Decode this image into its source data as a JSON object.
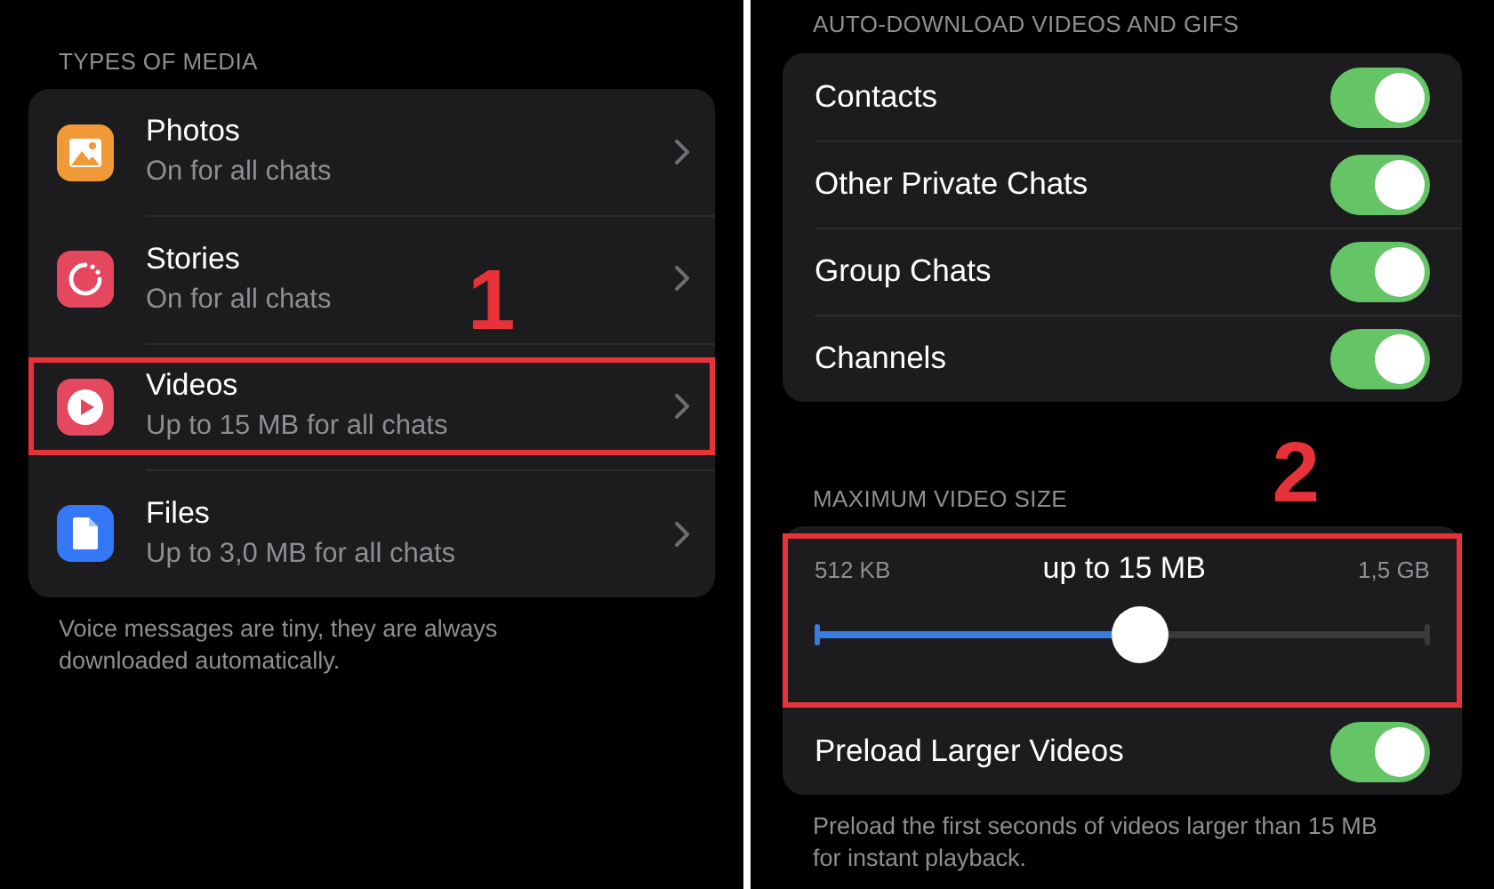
{
  "left": {
    "header": "TYPES OF MEDIA",
    "items": [
      {
        "kind": "photo",
        "color": "#f09a37",
        "title": "Photos",
        "subtitle": "On for all chats",
        "highlighted": false
      },
      {
        "kind": "story",
        "color": "#e5475f",
        "title": "Stories",
        "subtitle": "On for all chats",
        "highlighted": false
      },
      {
        "kind": "video",
        "color": "#e5475f",
        "title": "Videos",
        "subtitle": "Up to 15 MB for all chats",
        "highlighted": true
      },
      {
        "kind": "file",
        "color": "#3478f6",
        "title": "Files",
        "subtitle": "Up to 3,0 MB for all chats",
        "highlighted": false
      }
    ],
    "annotation": "1",
    "footer": "Voice messages are tiny, they are always downloaded automatically."
  },
  "right": {
    "header": "AUTO-DOWNLOAD VIDEOS AND GIFS",
    "toggles": [
      {
        "label": "Contacts",
        "on": true
      },
      {
        "label": "Other Private Chats",
        "on": true
      },
      {
        "label": "Group Chats",
        "on": true
      },
      {
        "label": "Channels",
        "on": true
      }
    ],
    "annotation": "2",
    "size_header": "MAXIMUM VIDEO SIZE",
    "slider": {
      "min": "512 KB",
      "value": "up to 15 MB",
      "max": "1,5 GB",
      "level": 0.53,
      "highlighted": true
    },
    "preload": {
      "label": "Preload Larger Videos",
      "on": true
    },
    "footer": "Preload the first seconds of videos larger than 15 MB for instant playback."
  }
}
